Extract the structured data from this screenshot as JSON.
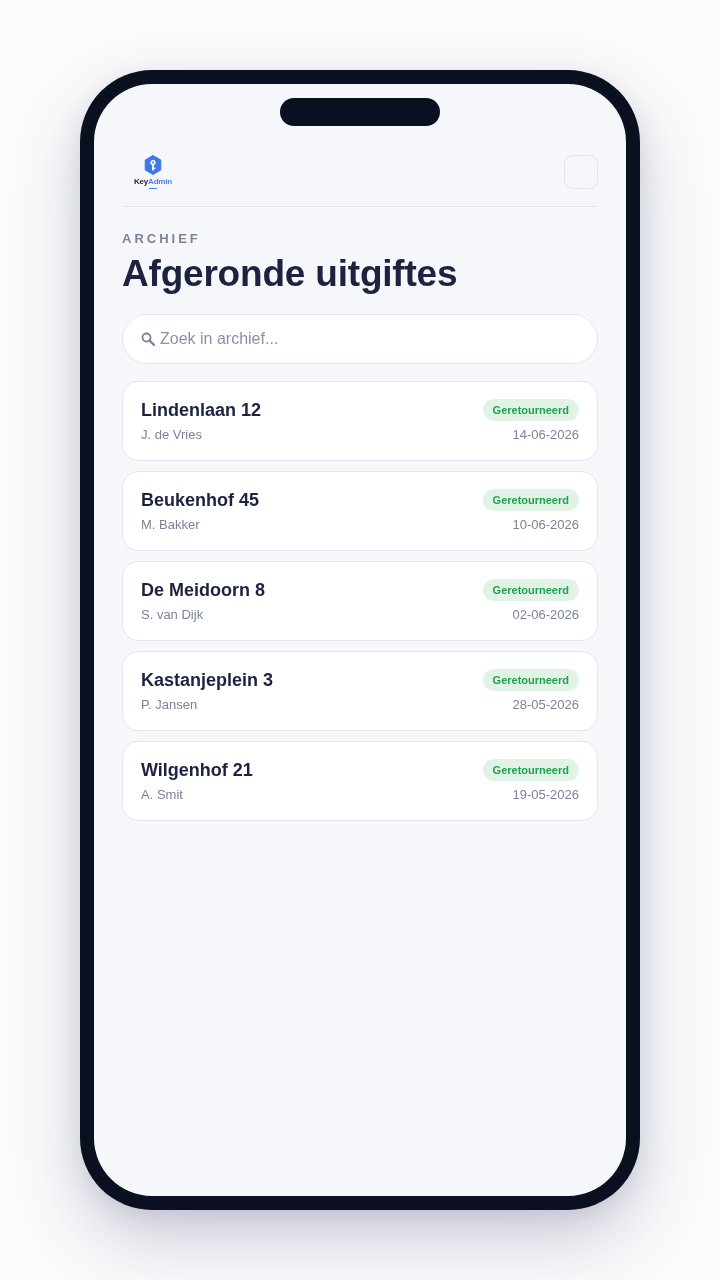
{
  "header": {
    "logo": {
      "name_parts": [
        "Key",
        "Admin"
      ]
    }
  },
  "page": {
    "eyebrow": "ARCHIEF",
    "title": "Afgeronde uitgiftes"
  },
  "search": {
    "placeholder": "Zoek in archief..."
  },
  "records": [
    {
      "address": "Lindenlaan 12",
      "person": "J. de Vries",
      "status": "Geretourneerd",
      "date": "14-06-2026"
    },
    {
      "address": "Beukenhof 45",
      "person": "M. Bakker",
      "status": "Geretourneerd",
      "date": "10-06-2026"
    },
    {
      "address": "De Meidoorn 8",
      "person": "S. van Dijk",
      "status": "Geretourneerd",
      "date": "02-06-2026"
    },
    {
      "address": "Kastanjeplein 3",
      "person": "P. Jansen",
      "status": "Geretourneerd",
      "date": "28-05-2026"
    },
    {
      "address": "Wilgenhof 21",
      "person": "A. Smit",
      "status": "Geretourneerd",
      "date": "19-05-2026"
    }
  ]
}
